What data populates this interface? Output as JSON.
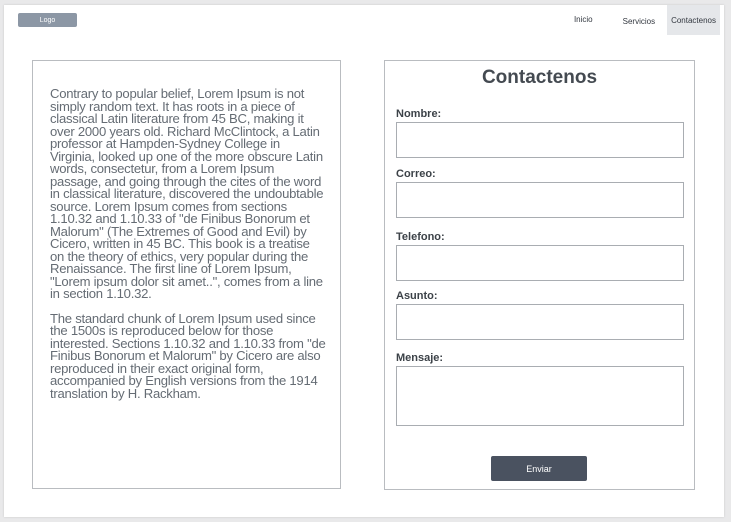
{
  "header": {
    "logo_label": "Logo",
    "nav": [
      {
        "label": "Inicio"
      },
      {
        "label": "Servicios"
      },
      {
        "label": "Contactenos"
      }
    ]
  },
  "article": {
    "paragraphs": [
      "Contrary to popular belief, Lorem Ipsum is not simply random text. It has roots in a piece of classical Latin literature from 45 BC, making it over 2000 years old. Richard McClintock, a Latin professor at Hampden-Sydney College in Virginia, looked up one of the more obscure Latin words, consectetur, from a Lorem Ipsum passage, and going through the cites of the word in classical literature, discovered the undoubtable source. Lorem Ipsum comes from sections 1.10.32 and 1.10.33 of \"de Finibus Bonorum et Malorum\" (The Extremes of Good and Evil) by Cicero, written in 45 BC. This book is a treatise on the theory of ethics, very popular during the Renaissance. The first line of Lorem Ipsum, \"Lorem ipsum dolor sit amet..\", comes from a line in section 1.10.32.",
      "The standard chunk of Lorem Ipsum used since the 1500s is reproduced below for those interested. Sections 1.10.32 and 1.10.33 from \"de Finibus Bonorum et Malorum\" by Cicero are also reproduced in their exact original form, accompanied by English versions from the 1914 translation by H. Rackham."
    ]
  },
  "contact_form": {
    "title": "Contactenos",
    "fields": [
      {
        "label": "Nombre:",
        "value": ""
      },
      {
        "label": "Correo:",
        "value": ""
      },
      {
        "label": "Telefono:",
        "value": ""
      },
      {
        "label": "Asunto:",
        "value": ""
      },
      {
        "label": "Mensaje:",
        "value": ""
      }
    ],
    "submit_label": "Enviar"
  }
}
